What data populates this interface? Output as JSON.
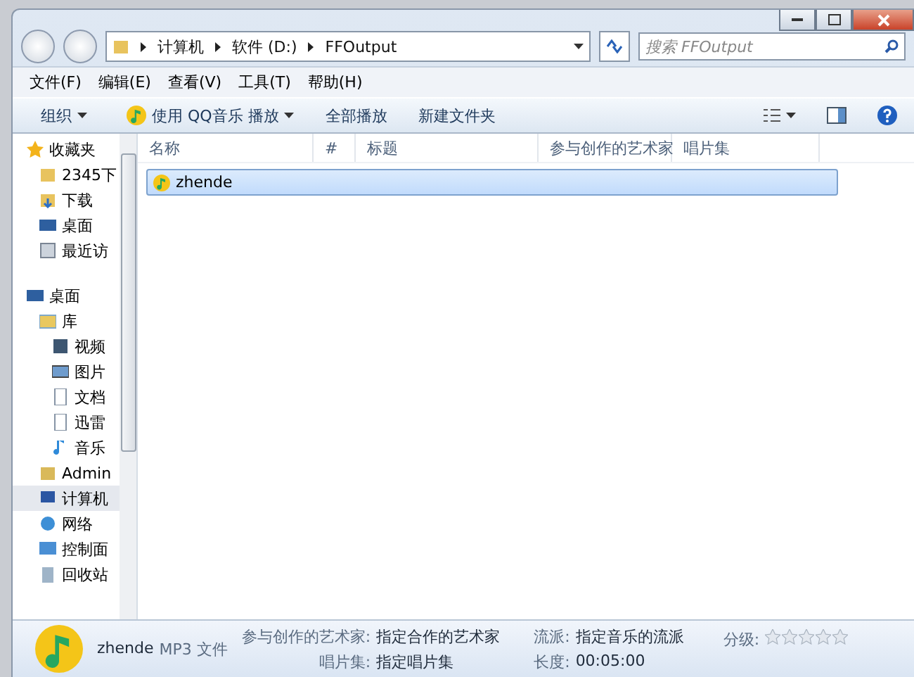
{
  "address": {
    "crumbs": [
      "计算机",
      "软件 (D:)",
      "FFOutput"
    ]
  },
  "search": {
    "placeholder": "搜索 FFOutput"
  },
  "menu": [
    "文件(F)",
    "编辑(E)",
    "查看(V)",
    "工具(T)",
    "帮助(H)"
  ],
  "toolbar": [
    {
      "kind": "dropdown",
      "label": "组织"
    },
    {
      "kind": "play",
      "label": "使用 QQ音乐 播放"
    },
    {
      "kind": "plain",
      "label": "全部播放"
    },
    {
      "kind": "plain",
      "label": "新建文件夹"
    }
  ],
  "sidebar": {
    "items": [
      {
        "label": "收藏夹",
        "selected": false,
        "children": [
          {
            "label": "2345下",
            "selected": false
          },
          {
            "label": "下载",
            "selected": false
          },
          {
            "label": "桌面",
            "selected": false
          },
          {
            "label": "最近访",
            "selected": false
          }
        ]
      },
      {
        "label": "桌面",
        "selected": false,
        "children": [
          {
            "label": "库",
            "selected": false,
            "children": [
              {
                "label": "视频",
                "selected": false
              },
              {
                "label": "图片",
                "selected": false
              },
              {
                "label": "文档",
                "selected": false
              },
              {
                "label": "迅雷",
                "selected": false
              },
              {
                "label": "音乐",
                "selected": false
              }
            ]
          },
          {
            "label": "Admin",
            "selected": false
          },
          {
            "label": "计算机",
            "selected": true
          },
          {
            "label": "网络",
            "selected": false
          },
          {
            "label": "控制面",
            "selected": false
          },
          {
            "label": "回收站",
            "selected": false
          }
        ]
      }
    ]
  },
  "table": {
    "columns": [
      "名称",
      "#",
      "标题",
      "参与创作的艺术家",
      "唱片集"
    ],
    "rows": [
      {
        "name": "zhende",
        "selected": true
      }
    ]
  },
  "details": {
    "name": "zhende",
    "type": "MP3 文件",
    "fields": [
      {
        "label": "参与创作的艺术家:",
        "value": "指定合作的艺术家"
      },
      {
        "label": "唱片集:",
        "value": "指定唱片集"
      },
      {
        "label": "流派:",
        "value": "指定音乐的流派"
      },
      {
        "label": "长度:",
        "value": "00:05:00"
      }
    ],
    "rating": {
      "label": "分级:",
      "stars": 0
    }
  }
}
